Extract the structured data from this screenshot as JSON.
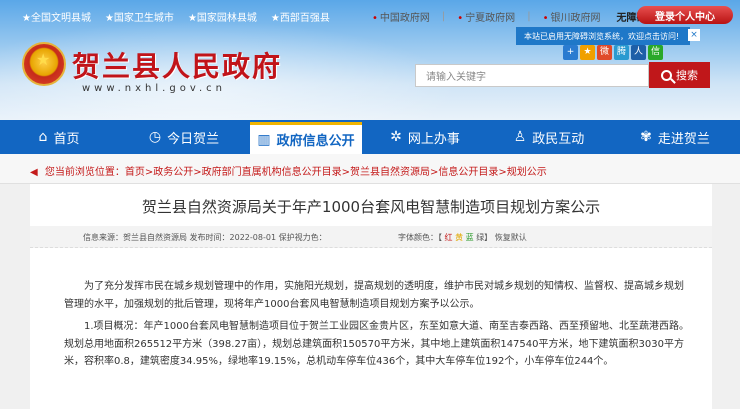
{
  "header": {
    "honors": [
      "★全国文明县城",
      "★国家卫生城市",
      "★国家园林县城",
      "★西部百强县"
    ],
    "top_links": [
      "中国政府网",
      "宁夏政府网",
      "银川政府网"
    ],
    "accessibility_label": "无障碍阅读",
    "login_label": "登录个人中心",
    "tooltip_text": "本站已启用无障碍浏览系统，欢迎点击访问!",
    "tooltip_close": "×",
    "site_title": "贺兰县人民政府",
    "site_url": "www.nxhl.gov.cn",
    "search_placeholder": "请输入关键字",
    "search_button": "搜索"
  },
  "nav": {
    "items": [
      {
        "icon": "home-icon",
        "glyph": "⌂",
        "label": "首页"
      },
      {
        "icon": "clock-icon",
        "glyph": "◷",
        "label": "今日贺兰"
      },
      {
        "icon": "book-icon",
        "glyph": "▥",
        "label": "政府信息公开"
      },
      {
        "icon": "gear-icon",
        "glyph": "✲",
        "label": "网上办事"
      },
      {
        "icon": "person-icon",
        "glyph": "♙",
        "label": "政民互动"
      },
      {
        "icon": "flower-icon",
        "glyph": "✾",
        "label": "走进贺兰"
      }
    ],
    "active_index": 2
  },
  "breadcrumb": {
    "speaker_glyph": "◀",
    "text": "您当前浏览位置：首页>政务公开>政府部门直属机构信息公开目录>贺兰县自然资源局>信息公开目录>规划公示"
  },
  "article": {
    "title": "贺兰县自然资源局关于年产1000台套风电智慧制造项目规划方案公示",
    "meta": "信息来源：贺兰县自然资源局  发布时间：2022-08-01  保护视力色：",
    "font_label": "字体颜色：【",
    "font_red": "红",
    "font_yellow": "黄",
    "font_green": "蓝",
    "font_end": "绿】 恢复默认",
    "paragraphs": [
      "为了充分发挥市民在城乡规划管理中的作用，实施阳光规划，提高规划的透明度，维护市民对城乡规划的知情权、监督权、提高城乡规划管理的水平，加强规划的批后管理，现将年产1000台套风电智慧制造项目规划方案予以公示。",
      "1.项目概况：年产1000台套风电智慧制造项目位于贺兰工业园区金贵片区，东至如意大道、南至吉泰西路、西至预留地、北至蔬港西路。规划总用地面积265512平方米（398.27亩），规划总建筑面积150570平方米，其中地上建筑面积147540平方米，地下建筑面积3030平方米，容积率0.8，建筑密度34.95%，绿地率19.15%，总机动车停车位436个，其中大车停车位192个，小车停车位244个。"
    ]
  },
  "share_icons": [
    {
      "name": "share-plus-icon",
      "color": "#2a7bd0",
      "glyph": "+"
    },
    {
      "name": "share-qzone-icon",
      "color": "#f0a000",
      "glyph": "★"
    },
    {
      "name": "share-weibo-icon",
      "color": "#e04a2a",
      "glyph": "微"
    },
    {
      "name": "share-tencent-icon",
      "color": "#2a9ad0",
      "glyph": "腾"
    },
    {
      "name": "share-renren-icon",
      "color": "#1d5fa8",
      "glyph": "人"
    },
    {
      "name": "share-wechat-icon",
      "color": "#2aa82a",
      "glyph": "信"
    }
  ]
}
